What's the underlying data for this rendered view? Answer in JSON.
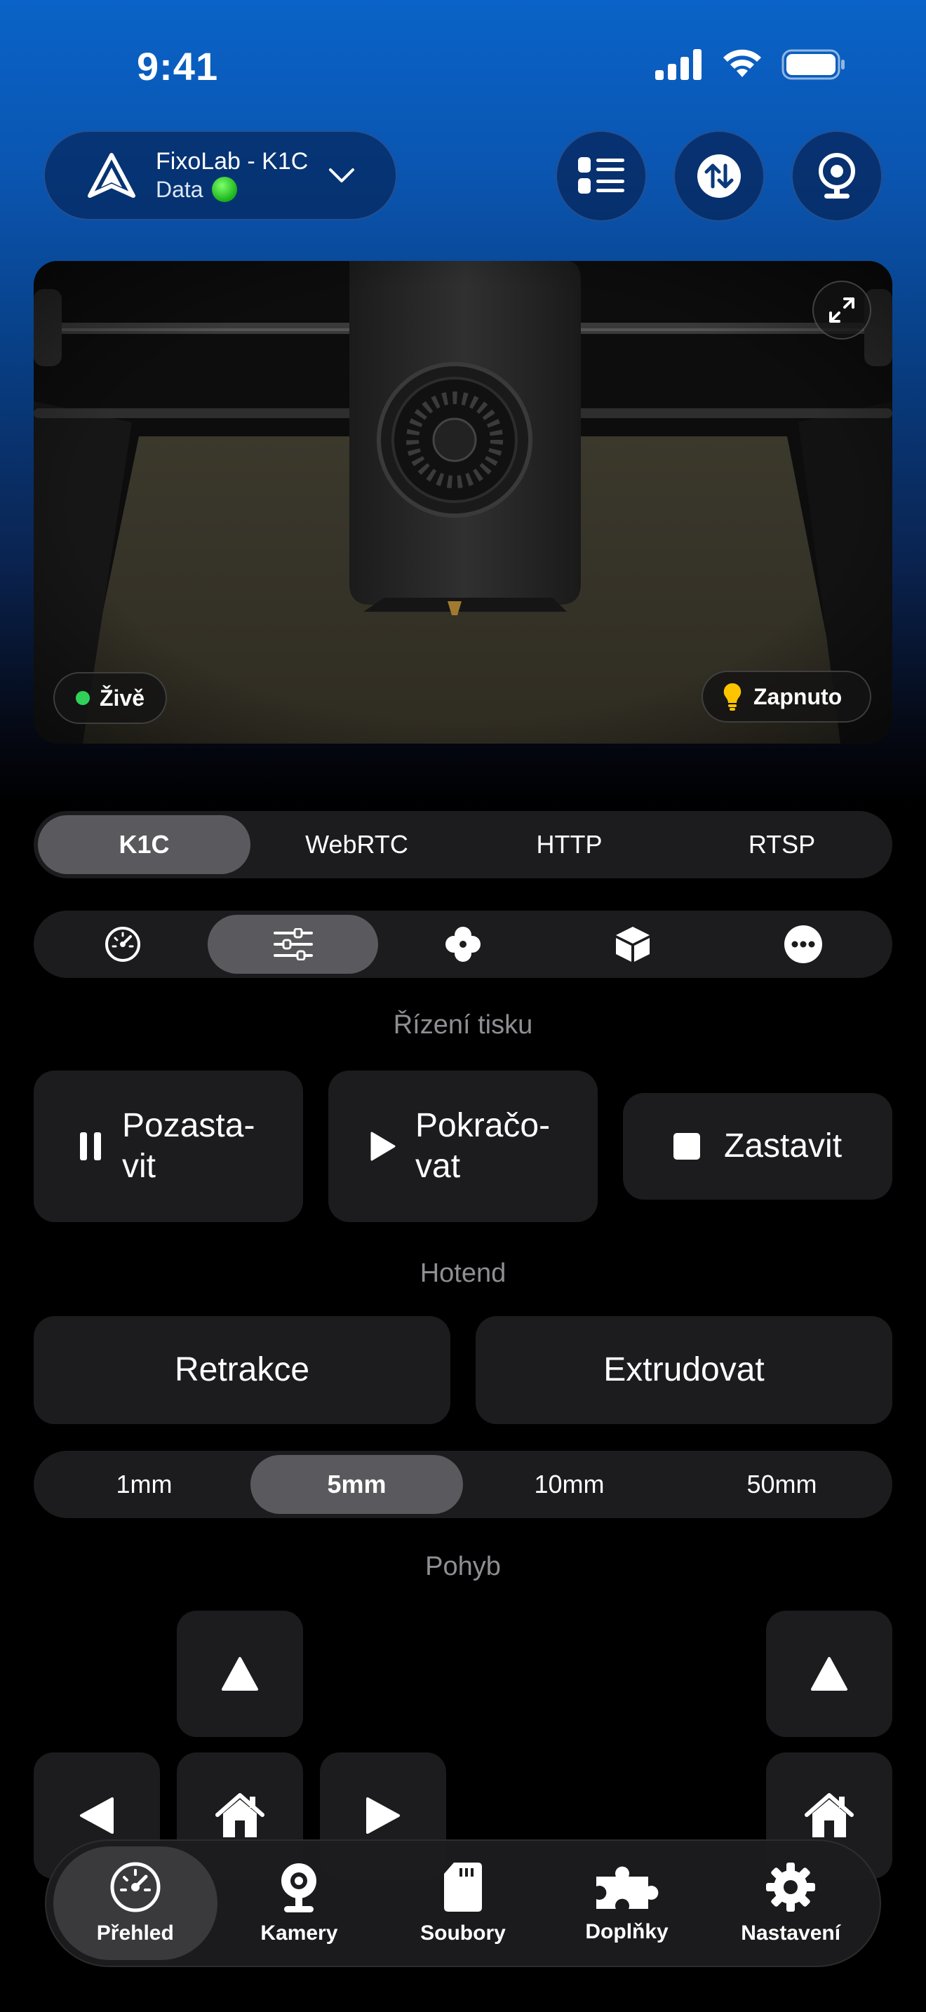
{
  "status_bar": {
    "time": "9:41"
  },
  "header": {
    "printer_name": "FixoLab - K1C",
    "printer_status": "Data"
  },
  "camera": {
    "live_label": "Živě",
    "light_label": "Zapnuto"
  },
  "camera_sources": {
    "options": [
      "K1C",
      "WebRTC",
      "HTTP",
      "RTSP"
    ],
    "selected": "K1C"
  },
  "control_tabs": {
    "icons": [
      "speedometer-icon",
      "sliders-icon",
      "fan-icon",
      "box-icon",
      "more-icon"
    ],
    "selected": "sliders-icon"
  },
  "print_control": {
    "title": "Řízení tisku",
    "pause": [
      "Pozasta-",
      "vit"
    ],
    "resume": [
      "Pokračo-",
      "vat"
    ],
    "stop": "Zastavit"
  },
  "hotend": {
    "title": "Hotend",
    "retract": "Retrakce",
    "extrude": "Extrudovat",
    "distances": [
      "1mm",
      "5mm",
      "10mm",
      "50mm"
    ],
    "selected_distance": "5mm"
  },
  "movement": {
    "title": "Pohyb"
  },
  "tab_bar": {
    "items": [
      "Přehled",
      "Kamery",
      "Soubory",
      "Doplňky",
      "Nastavení"
    ],
    "selected": "Přehled"
  },
  "colors": {
    "accent_green": "#30d158",
    "bulb_yellow": "#ffc400",
    "card_bg": "#1c1c1e",
    "active_segment": "#5a5a5e"
  }
}
